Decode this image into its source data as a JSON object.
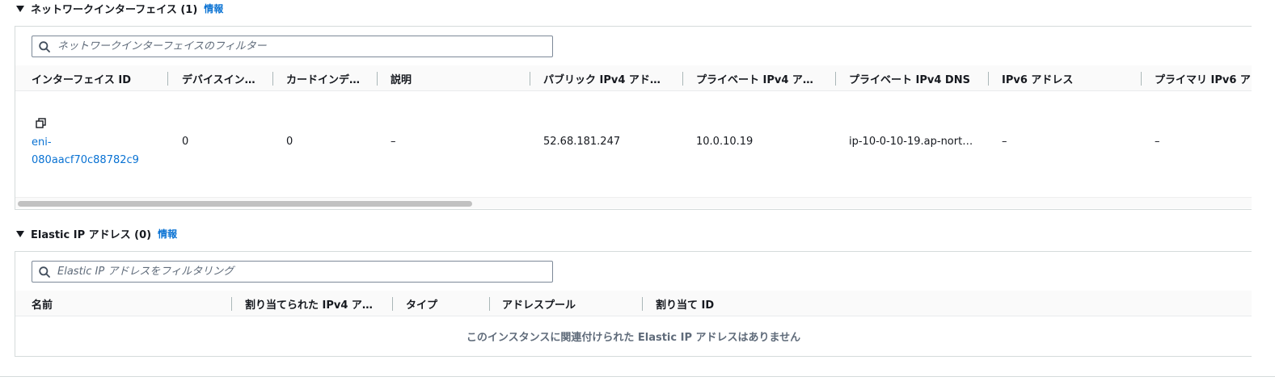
{
  "network_interfaces": {
    "title": "ネットワークインターフェイス (1)",
    "info": "情報",
    "filter_placeholder": "ネットワークインターフェイスのフィルター",
    "columns": [
      "インターフェイス ID",
      "デバイスイン…",
      "カードインデ…",
      "説明",
      "パブリック IPv4 アド…",
      "プライベート IPv4 ア…",
      "プライベート IPv4 DNS",
      "IPv6 アドレス",
      "プライマリ IPv6 ア"
    ],
    "row": {
      "interface_id_line1": "eni-",
      "interface_id_line2": "080aacf70c88782c9",
      "device_index": "0",
      "card_index": "0",
      "description": "–",
      "public_ipv4": "52.68.181.247",
      "private_ipv4": "10.0.10.19",
      "private_dns": "ip-10-0-10-19.ap-nort…",
      "ipv6": "–",
      "primary_ipv6": "–"
    }
  },
  "elastic_ip": {
    "title": "Elastic IP アドレス (0)",
    "info": "情報",
    "filter_placeholder": "Elastic IP アドレスをフィルタリング",
    "columns": [
      "名前",
      "割り当てられた IPv4 ア…",
      "タイプ",
      "アドレスプール",
      "割り当て ID"
    ],
    "empty_message": "このインスタンスに関連付けられた Elastic IP アドレスはありません"
  }
}
